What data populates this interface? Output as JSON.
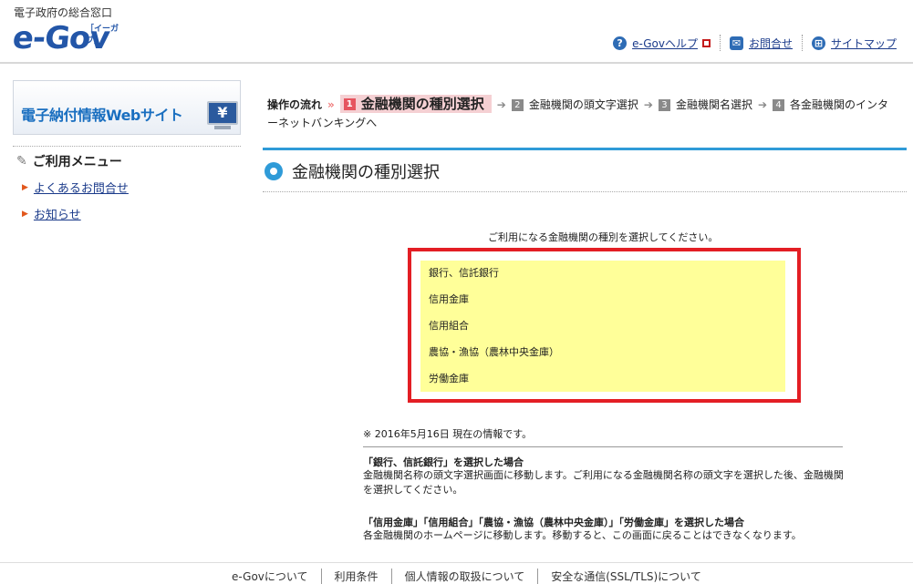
{
  "header": {
    "subtitle": "電子政府の総合窓口",
    "logo_main": "e-Gov",
    "logo_sub": "［イーガブ］",
    "links": [
      {
        "label": "e-Govヘルプ",
        "icon": "help-icon",
        "external": true
      },
      {
        "label": "お問合せ",
        "icon": "mail-icon"
      },
      {
        "label": "サイトマップ",
        "icon": "sitemap-icon"
      }
    ]
  },
  "sidebar": {
    "banner_text": "電子納付情報Webサイト",
    "banner_symbol": "¥",
    "menu_title": "ご利用メニュー",
    "menu_items": [
      {
        "label": "よくあるお問合せ"
      },
      {
        "label": "お知らせ"
      }
    ]
  },
  "flow": {
    "label": "操作の流れ",
    "chevrons": "»",
    "current_step": {
      "num": "1",
      "label": "金融機関の種別選択"
    },
    "steps": [
      {
        "num": "2",
        "label": "金融機関の頭文字選択"
      },
      {
        "num": "3",
        "label": "金融機関名選択"
      },
      {
        "num": "4",
        "label": "各金融機関のインターネットバンキングへ"
      }
    ]
  },
  "main": {
    "title": "金融機関の種別選択",
    "instruction": "ご利用になる金融機関の種別を選択してください。",
    "choices": [
      {
        "label": "銀行、信託銀行"
      },
      {
        "label": "信用金庫"
      },
      {
        "label": "信用組合"
      },
      {
        "label": "農協・漁協（農林中央金庫）"
      },
      {
        "label": "労働金庫"
      }
    ],
    "as_of": "※ 2016年5月16日 現在の情報です。",
    "notes": [
      {
        "heading": "「銀行、信託銀行」を選択した場合",
        "body": "金融機関名称の頭文字選択画面に移動します。ご利用になる金融機関名称の頭文字を選択した後、金融機関を選択してください。"
      },
      {
        "heading": "「信用金庫」「信用組合」「農協・漁協（農林中央金庫）」「労働金庫」を選択した場合",
        "body": "各金融機関のホームページに移動します。移動すると、この画面に戻ることはできなくなります。"
      }
    ]
  },
  "footer": {
    "links": [
      "e-Govについて",
      "利用条件",
      "個人情報の取扱について",
      "安全な通信(SSL/TLS)について"
    ]
  },
  "colors": {
    "accent_blue": "#2f9bd8",
    "highlight_red": "#e31e24",
    "choice_bg": "#ffff99",
    "current_step_bg": "#f5d0d3"
  }
}
